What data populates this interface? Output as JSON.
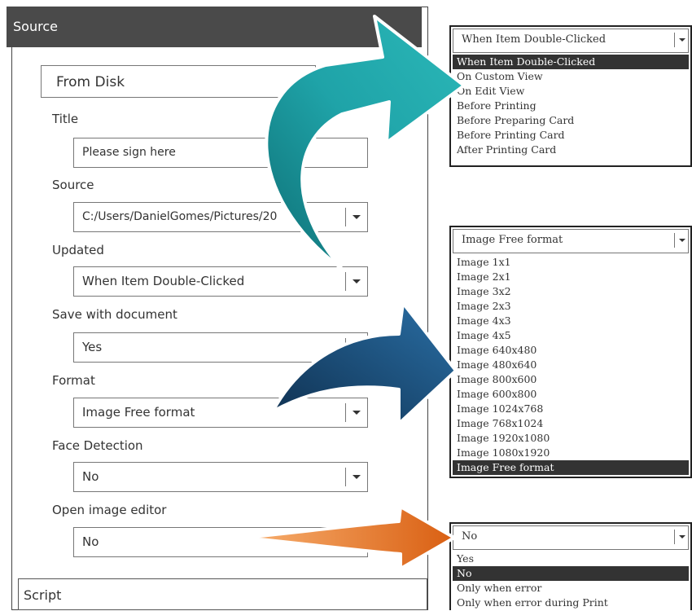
{
  "panel": {
    "header": "Source",
    "mode": "From Disk",
    "fields": [
      {
        "label": "Title",
        "value": "Please sign here",
        "type": "text"
      },
      {
        "label": "Source",
        "value": "C:/Users/DanielGomes/Pictures/20",
        "type": "select"
      },
      {
        "label": "Updated",
        "value": "When Item Double-Clicked",
        "type": "select"
      },
      {
        "label": "Save with document",
        "value": "Yes",
        "type": "select"
      },
      {
        "label": "Format",
        "value": "Image Free format",
        "type": "select"
      },
      {
        "label": "Face Detection",
        "value": "No",
        "type": "select"
      },
      {
        "label": "Open image editor",
        "value": "No",
        "type": "select"
      }
    ],
    "script_label": "Script"
  },
  "popups": [
    {
      "selected": "When Item Double-Clicked",
      "options": [
        "When Item Double-Clicked",
        "On Custom View",
        "On Edit View",
        "Before Printing",
        "Before Preparing Card",
        "Before Printing Card",
        "After Printing Card"
      ],
      "active_index": 0
    },
    {
      "selected": "Image Free format",
      "options": [
        "Image 1x1",
        "Image 2x1",
        "Image 3x2",
        "Image 2x3",
        "Image 4x3",
        "Image 4x5",
        "Image 640x480",
        "Image 480x640",
        "Image 800x600",
        "Image 600x800",
        "Image 1024x768",
        "Image 768x1024",
        "Image 1920x1080",
        "Image 1080x1920",
        "Image Free format"
      ],
      "active_index": 14
    },
    {
      "selected": "No",
      "options": [
        "Yes",
        "No",
        "Only when error",
        "Only when error during Print"
      ],
      "active_index": 1
    }
  ],
  "colors": {
    "header_bg": "#4a4a4a",
    "arrow_teal": "#1a8f96",
    "arrow_navy": "#1d4f7a",
    "arrow_orange": "#e0701e",
    "selection": "#333333"
  }
}
